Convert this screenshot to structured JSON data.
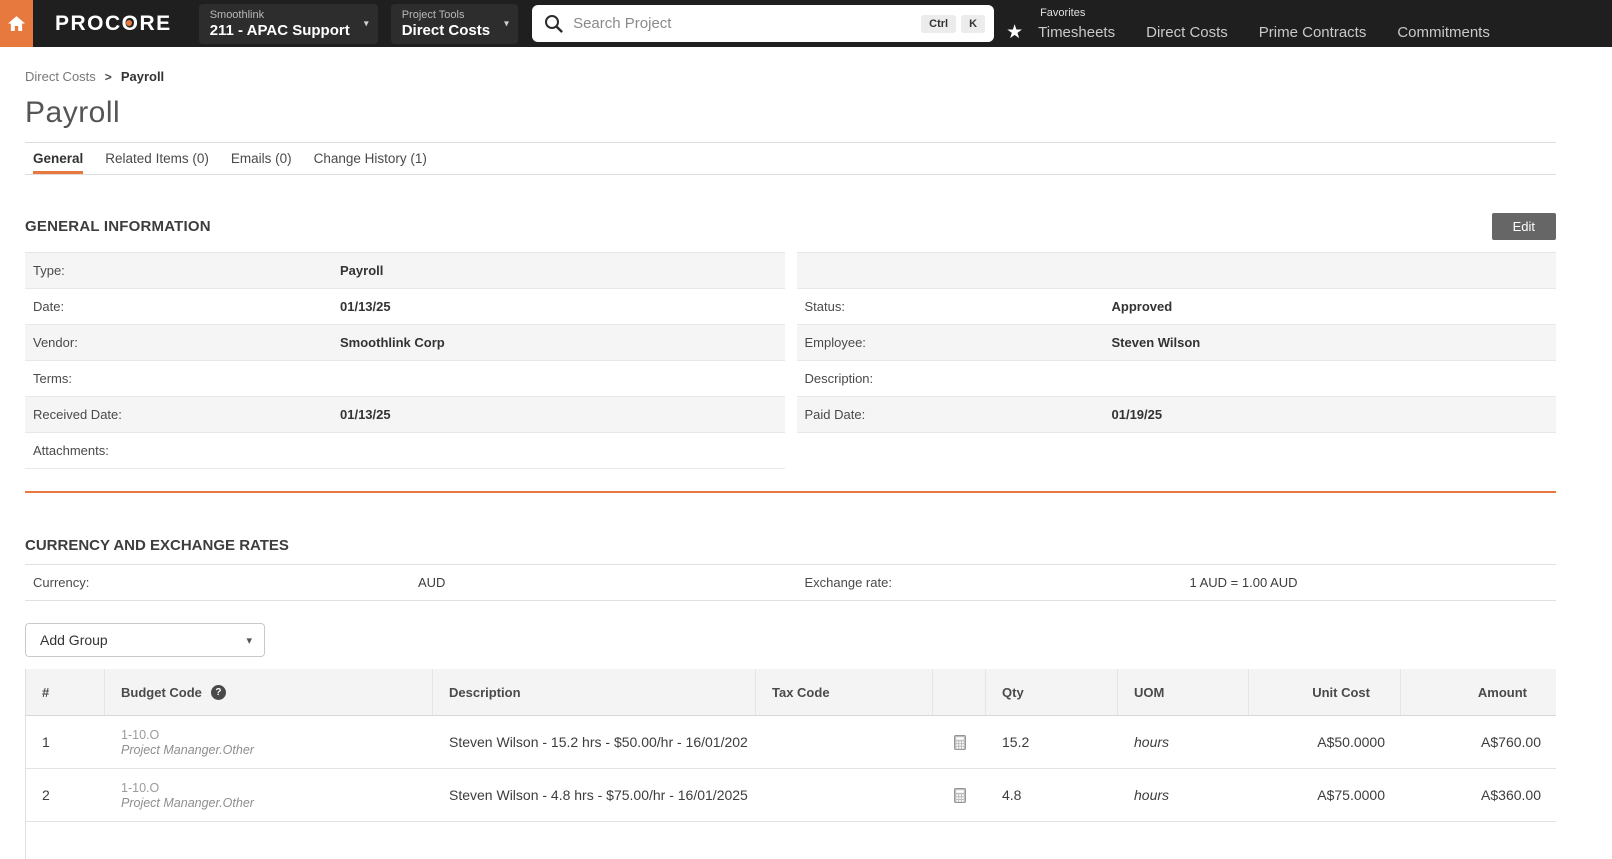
{
  "nav": {
    "logo": "PROCORE",
    "company_picker": {
      "label": "Smoothlink",
      "value": "211 - APAC Support"
    },
    "tool_picker": {
      "label": "Project Tools",
      "value": "Direct Costs"
    },
    "search": {
      "placeholder": "Search Project",
      "shortcut_keys": [
        "Ctrl",
        "K"
      ]
    },
    "favorites_label": "Favorites",
    "favorites": [
      "Timesheets",
      "Direct Costs",
      "Prime Contracts",
      "Commitments"
    ]
  },
  "breadcrumb": {
    "parent": "Direct Costs",
    "current": "Payroll"
  },
  "page_title": "Payroll",
  "tabs": [
    {
      "label": "General"
    },
    {
      "label": "Related Items (0)"
    },
    {
      "label": "Emails (0)"
    },
    {
      "label": "Change History (1)"
    }
  ],
  "general_info": {
    "heading": "GENERAL INFORMATION",
    "edit_button_label": "Edit",
    "left_fields": [
      {
        "label": "Type:",
        "value": "Payroll"
      },
      {
        "label": "Date:",
        "value": "01/13/25"
      },
      {
        "label": "Vendor:",
        "value": "Smoothlink Corp"
      },
      {
        "label": "Terms:",
        "value": ""
      },
      {
        "label": "Received Date:",
        "value": "01/13/25"
      },
      {
        "label": "Attachments:",
        "value": ""
      }
    ],
    "right_fields": [
      {
        "label": "",
        "value": ""
      },
      {
        "label": "Status:",
        "value": "Approved"
      },
      {
        "label": "Employee:",
        "value": "Steven Wilson"
      },
      {
        "label": "Description:",
        "value": ""
      },
      {
        "label": "Paid Date:",
        "value": "01/19/25"
      }
    ]
  },
  "currency_section": {
    "heading": "CURRENCY AND EXCHANGE RATES",
    "currency_label": "Currency:",
    "currency_value": "AUD",
    "exchange_rate_label": "Exchange rate:",
    "exchange_rate_value": "1 AUD = 1.00 AUD"
  },
  "line_items": {
    "add_group_label": "Add Group",
    "columns": [
      "#",
      "Budget Code",
      "Description",
      "Tax Code",
      "",
      "Qty",
      "UOM",
      "Unit Cost",
      "Amount"
    ],
    "rows": [
      {
        "num": "1",
        "budget_code": "1-10.O",
        "budget_category": "Project Mananger.Other",
        "description": "Steven Wilson - 15.2 hrs - $50.00/hr - 16/01/202",
        "tax_code": "",
        "qty": "15.2",
        "uom": "hours",
        "unit_cost": "A$50.0000",
        "amount": "A$760.00"
      },
      {
        "num": "2",
        "budget_code": "1-10.O",
        "budget_category": "Project Mananger.Other",
        "description": "Steven Wilson - 4.8 hrs - $75.00/hr - 16/01/2025",
        "tax_code": "",
        "qty": "4.8",
        "uom": "hours",
        "unit_cost": "A$75.0000",
        "amount": "A$360.00"
      }
    ]
  },
  "colors": {
    "brand_orange": "#e8793e",
    "nav_background": "#1f1f1f",
    "edit_button_gray": "#666666",
    "row_stripe_gray": "#f5f5f5"
  }
}
